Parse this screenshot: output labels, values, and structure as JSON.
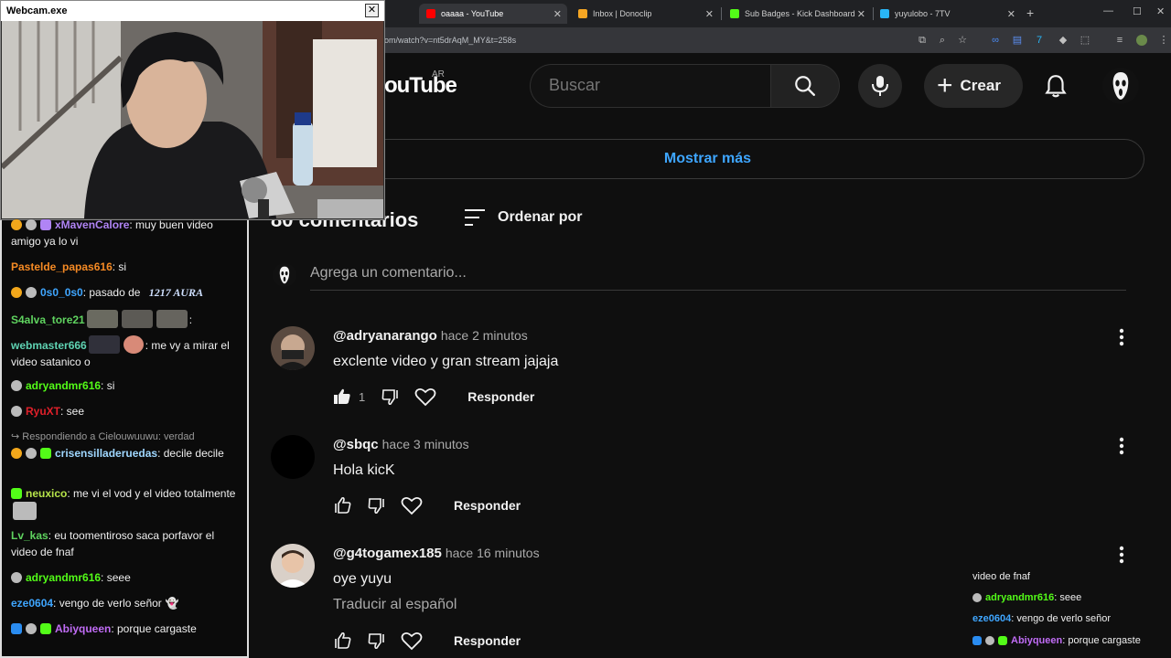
{
  "browser": {
    "tabs": [
      {
        "label": "oaaaa - YouTube",
        "color": "#ff0000"
      },
      {
        "label": "Inbox | Donoclip",
        "color": "#f5a623"
      },
      {
        "label": "Sub Badges - Kick Dashboard",
        "color": "#53fc18"
      },
      {
        "label": "yuyulobo - 7TV",
        "color": "#29b6f6"
      }
    ],
    "url": "om/watch?v=nt5drAqM_MY&t=258s"
  },
  "youtube": {
    "logo": "ouTube",
    "region": "AR",
    "search_placeholder": "Buscar",
    "create_label": "Crear",
    "show_more": "Mostrar más",
    "comments_count": "80 comentarios",
    "sort_label": "Ordenar por",
    "add_comment_placeholder": "Agrega un comentario...",
    "comments": [
      {
        "author": "@adryanarango",
        "time": "hace 2 minutos",
        "text": "exclente video y gran stream jajaja",
        "likes": "1",
        "reply": "Responder"
      },
      {
        "author": "@sbqc",
        "time": "hace 3 minutos",
        "text": "Hola kicK",
        "likes": "",
        "reply": "Responder"
      },
      {
        "author": "@g4togamex185",
        "time": "hace 16 minutos",
        "text": "oye yuyu",
        "translate": "Traducir al español",
        "likes": "",
        "reply": "Responder"
      }
    ]
  },
  "webcam": {
    "title": "Webcam.exe",
    "close": "✕"
  },
  "chat": {
    "messages": [
      {
        "user": "xMavenCalore",
        "color": "#b084f5",
        "text": ": muy buen video amigo ya lo vi"
      },
      {
        "user": "Pastelde_papas616",
        "color": "#f58a24",
        "text": ": si"
      },
      {
        "user": "0s0_0s0",
        "color": "#3fa6ff",
        "text": ": pasado de",
        "emote_text": "1217 AURA"
      },
      {
        "user": "S4alva_tore21",
        "color": "#5fd35f",
        "text": ":"
      },
      {
        "user": "webmaster666",
        "color": "#5fd3b3",
        "text": ": me vy a mirar el video satanico o"
      },
      {
        "user": "adryandmr616",
        "color": "#53fc18",
        "text": ": si"
      },
      {
        "user": "RyuXT",
        "color": "#e0202a",
        "text": ": see"
      },
      {
        "reply_to": "Respondiendo a Cielouwuuwu: verdad",
        "user": "crisensilladeruedas",
        "color": "#9fd7ff",
        "text": ": decile decile"
      },
      {
        "user": "neuxico",
        "color": "#b6e34a",
        "text": ": me vi el vod y el video totalmente"
      },
      {
        "user": "Lv_kas",
        "color": "#5fd35f",
        "text": ": eu toomentiroso saca porfavor el video de fnaf"
      },
      {
        "user": "adryandmr616",
        "color": "#53fc18",
        "text": ": seee"
      },
      {
        "user": "eze0604",
        "color": "#3fa6ff",
        "text": ": vengo de verlo señor"
      },
      {
        "user": "Abiyqueen",
        "color": "#c06cf5",
        "text": ": porque cargaste"
      }
    ]
  },
  "mini_chat": {
    "lines": [
      {
        "user": "",
        "color": "#efefef",
        "text": "video de fnaf"
      },
      {
        "user": "adryandmr616",
        "color": "#53fc18",
        "text": ": seee"
      },
      {
        "user": "eze0604",
        "color": "#3fa6ff",
        "text": ": vengo de verlo señor"
      },
      {
        "user": "Abiyqueen",
        "color": "#c06cf5",
        "text": ": porque cargaste"
      }
    ]
  }
}
